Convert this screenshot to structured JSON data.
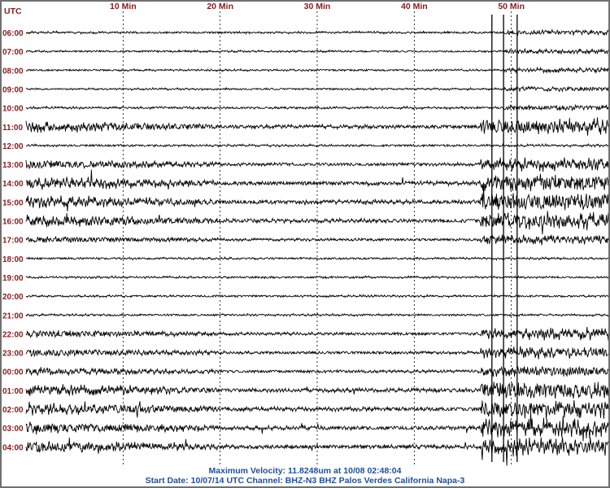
{
  "chart_data": {
    "type": "line",
    "x_axis": {
      "unit_label": "UTC",
      "tick_labels": [
        "10 Min",
        "20 Min",
        "30 Min",
        "40 Min",
        "50 Min"
      ],
      "xlim_minutes": [
        0,
        60
      ]
    },
    "row_labels": [
      "06:00",
      "07:00",
      "08:00",
      "09:00",
      "10:00",
      "11:00",
      "12:00",
      "13:00",
      "14:00",
      "15:00",
      "16:00",
      "17:00",
      "18:00",
      "19:00",
      "20:00",
      "21:00",
      "22:00",
      "23:00",
      "00:00",
      "01:00",
      "02:00",
      "03:00",
      "04:00"
    ],
    "grid": true,
    "colors": {
      "trace": "#000000",
      "axis_labels": "#8b1a1a",
      "footer_text": "#1f4f9e",
      "gridline": "#000000",
      "frame": "#707070"
    },
    "activity_levels": [
      0.3,
      0.25,
      0.25,
      0.25,
      0.35,
      0.9,
      0.35,
      0.7,
      1.0,
      1.0,
      1.0,
      0.5,
      0.3,
      0.3,
      0.3,
      0.3,
      0.6,
      0.6,
      0.6,
      1.0,
      1.0,
      1.0,
      1.0
    ],
    "max_velocity_text": "Maximum Velocity: 11.8248um at 10/08 02:48:04",
    "footer_text": "Start Date: 10/07/14 UTC Channel: BHZ-N3  BHZ  Palos Verdes California  Napa-3"
  }
}
